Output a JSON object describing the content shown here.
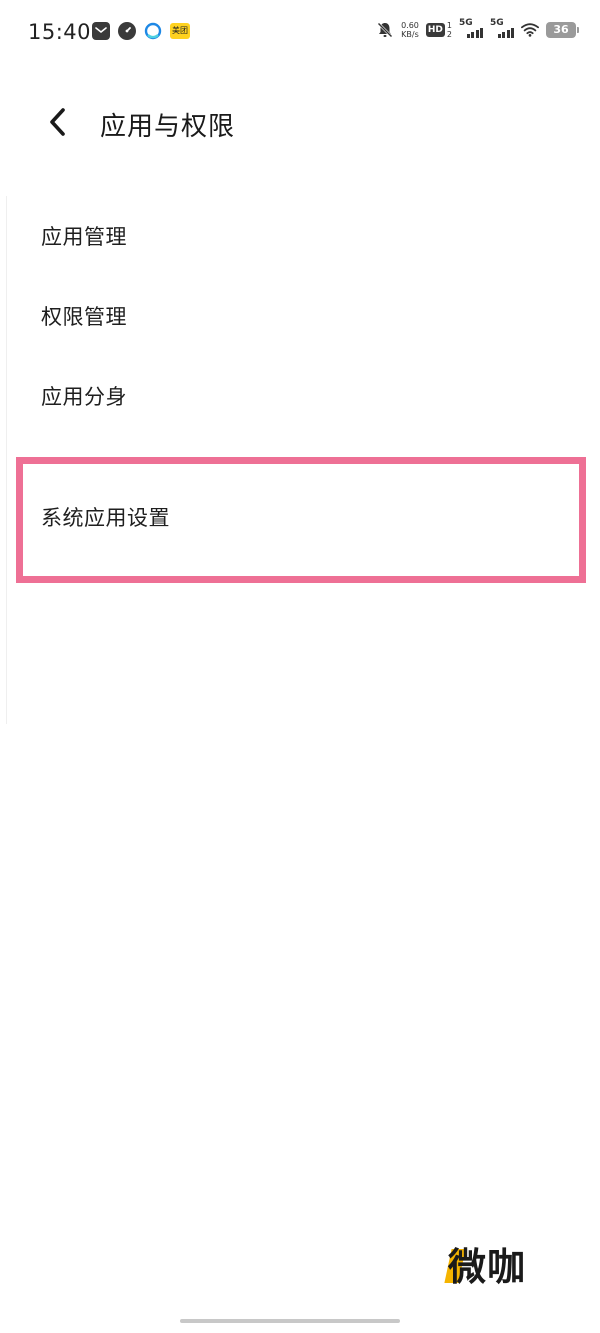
{
  "status_bar": {
    "time": "15:40",
    "notification_icons": [
      "mail-icon",
      "speedometer-icon",
      "browser-icon",
      "meituan-app-icon"
    ],
    "meituan_label": "美团",
    "net_speed_value": "0.60",
    "net_speed_unit": "KB/s",
    "hd_label": "HD",
    "sim_index_top": "1",
    "sim_index_bottom": "2",
    "signal1_label": "5G",
    "signal2_label": "5G",
    "battery_level": "36"
  },
  "header": {
    "back_icon": "chevron-left-icon",
    "title": "应用与权限"
  },
  "menu": {
    "items": [
      {
        "label": "应用管理"
      },
      {
        "label": "权限管理"
      },
      {
        "label": "应用分身"
      },
      {
        "label": "系统应用设置",
        "highlighted": true
      }
    ]
  },
  "highlight_color": "#ee7095",
  "watermark": {
    "text": "微咖",
    "accent_color": "#f5b400"
  }
}
